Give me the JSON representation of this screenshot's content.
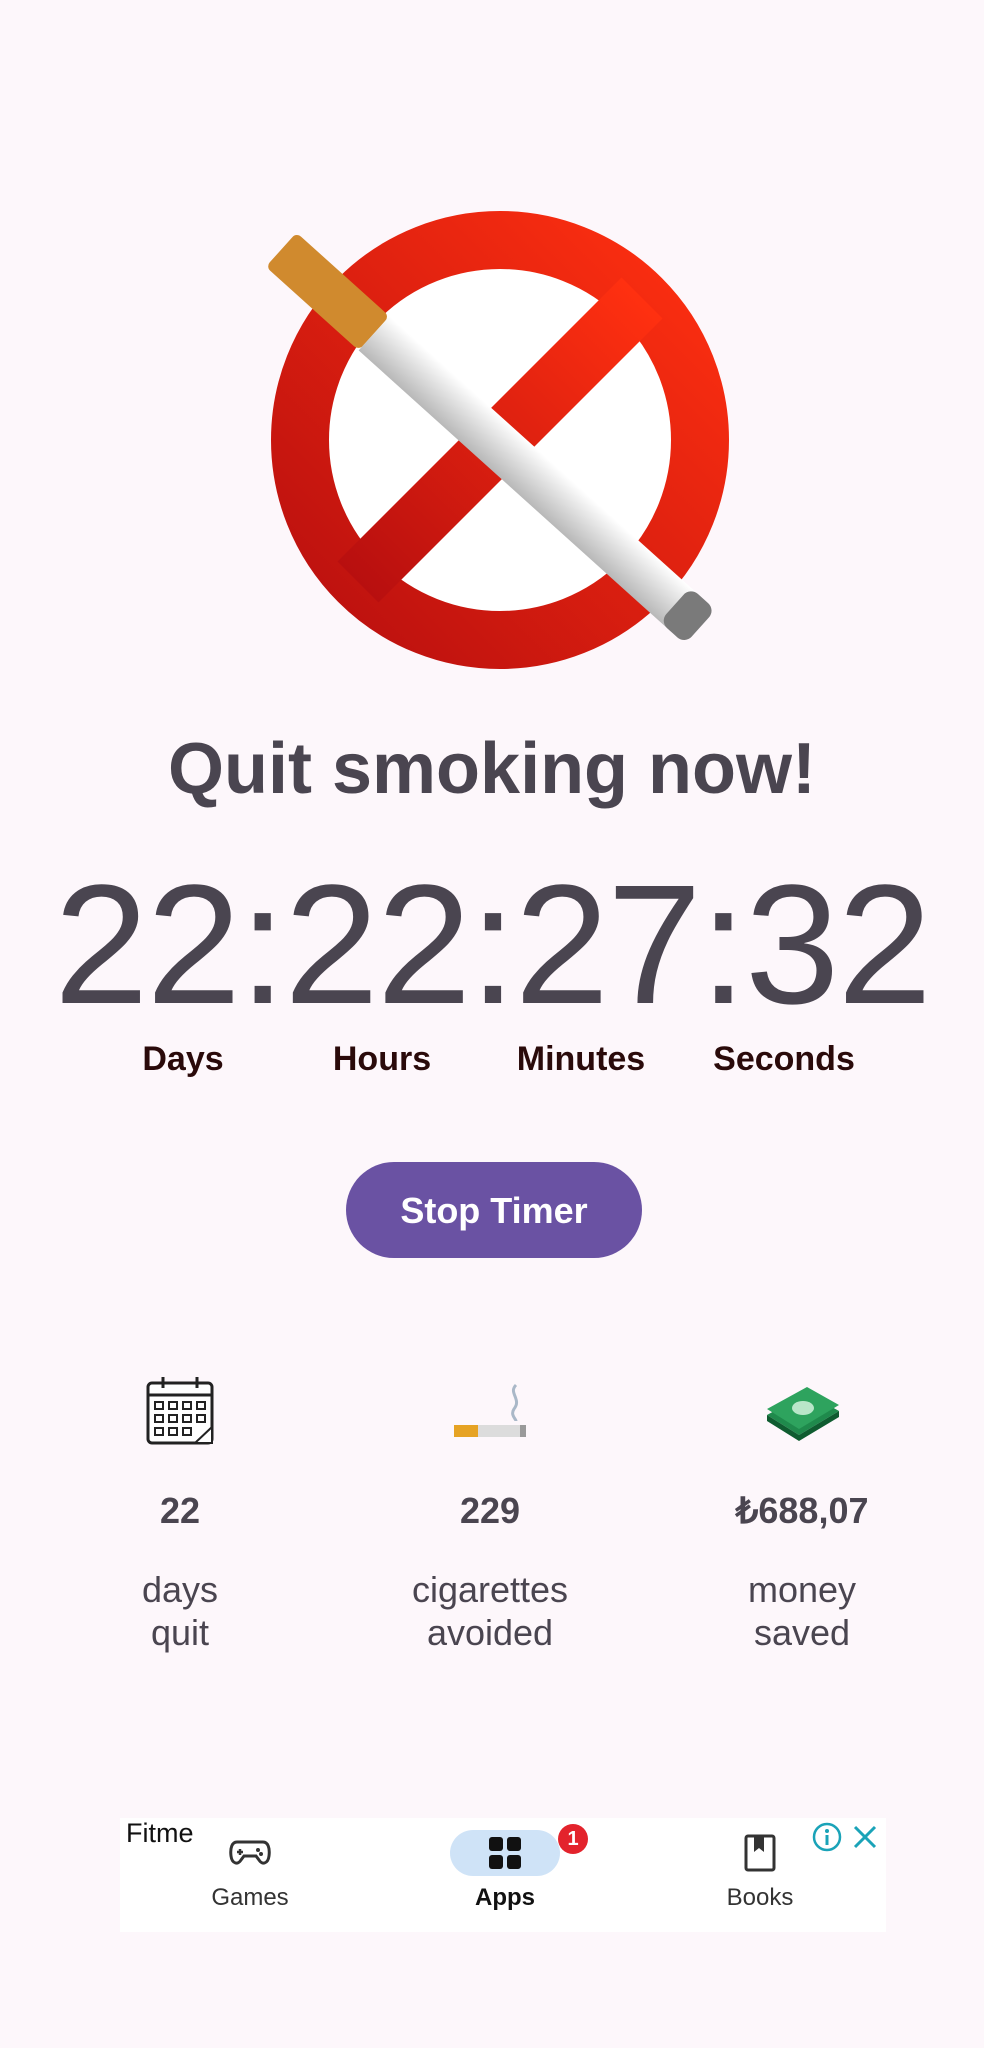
{
  "header": {
    "title": "Quit smoking now!"
  },
  "timer": {
    "display": "22:22:27:32",
    "units": [
      "Days",
      "Hours",
      "Minutes",
      "Seconds"
    ]
  },
  "actions": {
    "stop_label": "Stop Timer"
  },
  "stats": [
    {
      "icon": "calendar-icon",
      "value": "22",
      "label_line1": "days",
      "label_line2": "quit"
    },
    {
      "icon": "cigarette-icon",
      "value": "229",
      "label_line1": "cigarettes",
      "label_line2": "avoided"
    },
    {
      "icon": "money-icon",
      "value": "₺688,07",
      "label_line1": "money",
      "label_line2": "saved"
    }
  ],
  "ad": {
    "brand": "Fitme",
    "nav": [
      {
        "icon": "gamepad-icon",
        "label": "Games"
      },
      {
        "icon": "apps-grid-icon",
        "label": "Apps",
        "badge": "1"
      },
      {
        "icon": "bookmark-book-icon",
        "label": "Books"
      }
    ]
  },
  "colors": {
    "accent": "#6a52a3",
    "no_sign": "#e8231a",
    "background": "#fdf7fb"
  }
}
